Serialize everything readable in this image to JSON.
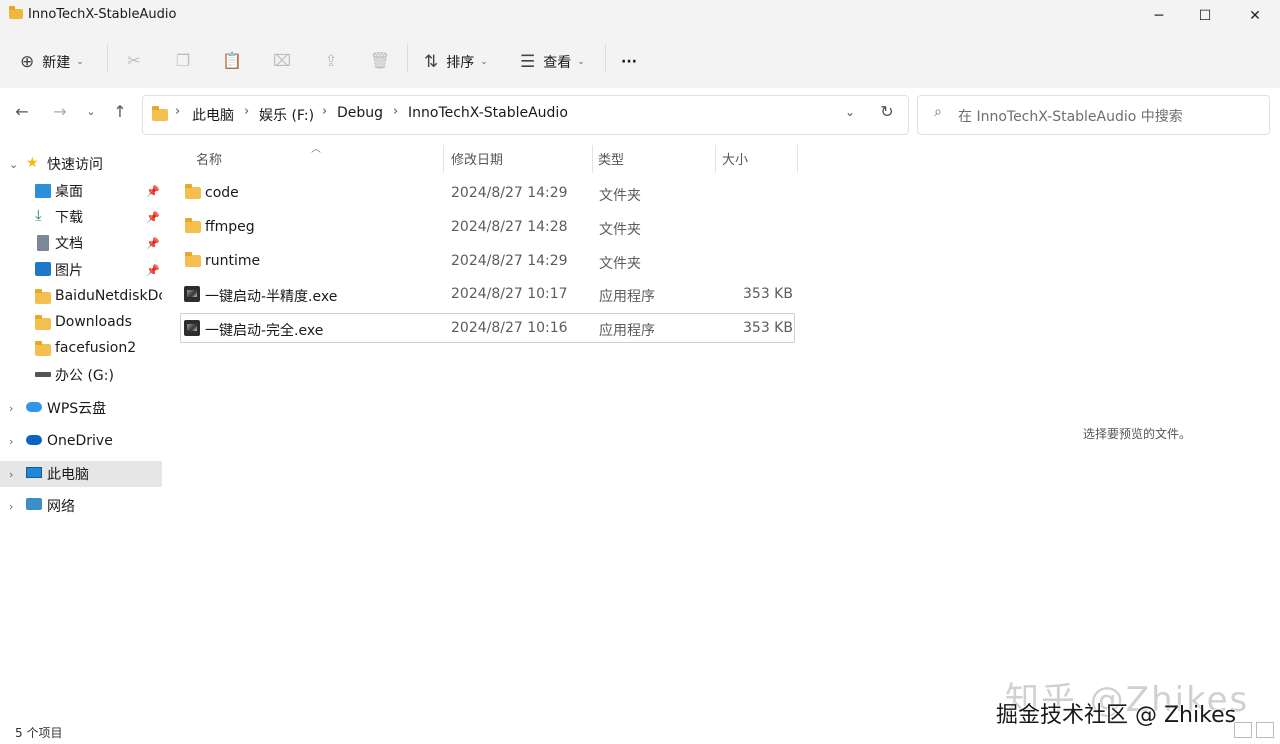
{
  "window": {
    "title": "InnoTechX-StableAudio"
  },
  "toolbar": {
    "new_label": "新建",
    "sort_label": "排序",
    "view_label": "查看",
    "more_label": "···"
  },
  "address": {
    "breadcrumbs": [
      "此电脑",
      "娱乐 (F:)",
      "Debug",
      "InnoTechX-StableAudio"
    ]
  },
  "search": {
    "placeholder": "在 InnoTechX-StableAudio 中搜索"
  },
  "sidebar": {
    "quick_access": "快速访问",
    "items": [
      {
        "label": "桌面",
        "icon": "desktop-icon",
        "pinned": true
      },
      {
        "label": "下载",
        "icon": "download-icon",
        "pinned": true
      },
      {
        "label": "文档",
        "icon": "document-icon",
        "pinned": true
      },
      {
        "label": "图片",
        "icon": "picture-icon",
        "pinned": true
      },
      {
        "label": "BaiduNetdiskDc",
        "icon": "folder-icon",
        "pinned": false
      },
      {
        "label": "Downloads",
        "icon": "folder-icon",
        "pinned": false
      },
      {
        "label": "facefusion2",
        "icon": "folder-icon",
        "pinned": false
      },
      {
        "label": "办公 (G:)",
        "icon": "drive-icon",
        "pinned": false
      }
    ],
    "wps": "WPS云盘",
    "onedrive": "OneDrive",
    "this_pc": "此电脑",
    "network": "网络"
  },
  "columns": {
    "name": "名称",
    "date": "修改日期",
    "type": "类型",
    "size": "大小"
  },
  "files": [
    {
      "name": "code",
      "date": "2024/8/27 14:29",
      "type": "文件夹",
      "size": "",
      "icon": "folder-icon"
    },
    {
      "name": "ffmpeg",
      "date": "2024/8/27 14:28",
      "type": "文件夹",
      "size": "",
      "icon": "folder-icon"
    },
    {
      "name": "runtime",
      "date": "2024/8/27 14:29",
      "type": "文件夹",
      "size": "",
      "icon": "folder-icon"
    },
    {
      "name": "一键启动-半精度.exe",
      "date": "2024/8/27 10:17",
      "type": "应用程序",
      "size": "353 KB",
      "icon": "exe-icon"
    },
    {
      "name": "一键启动-完全.exe",
      "date": "2024/8/27 10:16",
      "type": "应用程序",
      "size": "353 KB",
      "icon": "exe-icon"
    }
  ],
  "preview": {
    "message": "选择要预览的文件。"
  },
  "status": {
    "item_count": "5 个项目"
  },
  "watermark": {
    "line1": "知乎 @Zhikes",
    "line2": "掘金技术社区 @ Zhikes"
  },
  "colors": {
    "accent": "#0067c0",
    "folder": "#f3c04f",
    "selection": "#e6e6e6"
  }
}
